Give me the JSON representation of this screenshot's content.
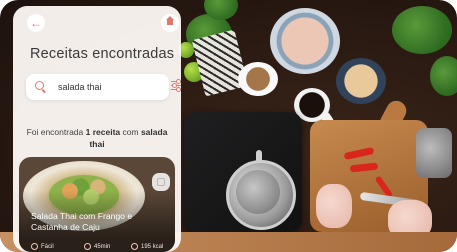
{
  "header": {
    "back_icon": "arrow-left-icon",
    "home_icon": "home-icon",
    "title": "Receitas encontradas"
  },
  "search": {
    "value": "salada thai",
    "icon": "search-icon",
    "filter_icon": "filter-sliders-icon"
  },
  "result": {
    "prefix": "Foi encontrada",
    "count_label": "1 receita",
    "middle": "com",
    "query": "salada thai"
  },
  "recipe_card": {
    "title": "Salada Thai com Frango e Castanha de Caju",
    "difficulty": "Fácil",
    "time": "45min",
    "calories": "195 kcal",
    "bookmark_icon": "bookmark-icon"
  },
  "colors": {
    "accent": "#e07870",
    "panel_bg": "#fcf7f4",
    "title_text": "#3a3a3a"
  }
}
